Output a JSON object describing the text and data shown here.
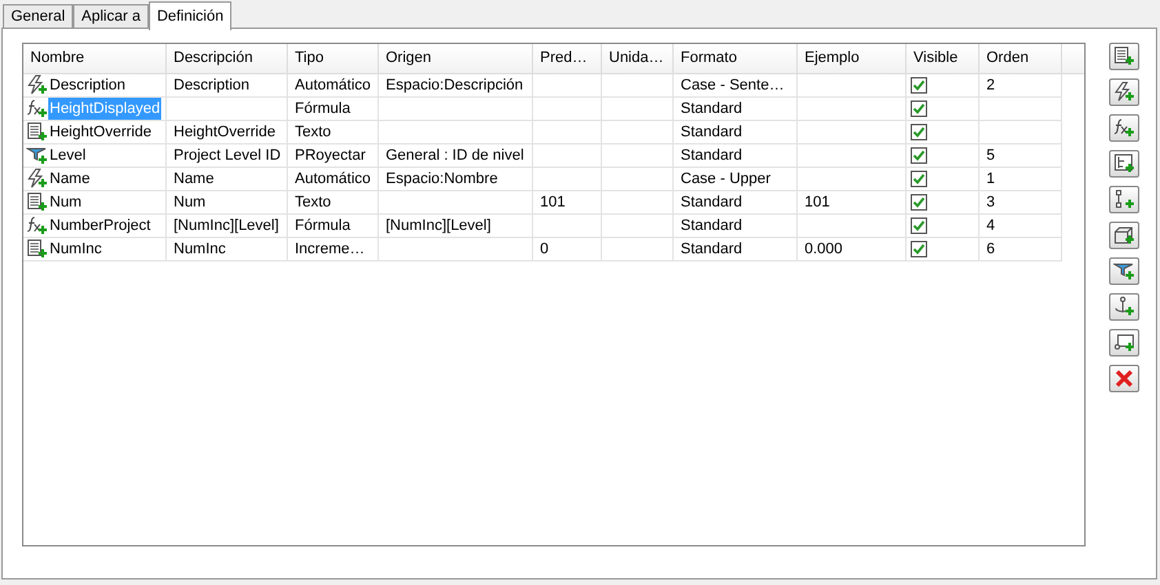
{
  "tabs": [
    {
      "label": "General",
      "selected": false
    },
    {
      "label": "Aplicar a",
      "selected": false
    },
    {
      "label": "Definición",
      "selected": true
    }
  ],
  "table": {
    "columns": [
      "Nombre",
      "Descripción",
      "Tipo",
      "Origen",
      "Pred…",
      "Unida…",
      "Formato",
      "Ejemplo",
      "Visible",
      "Orden"
    ],
    "rows": [
      {
        "kind": "auto",
        "selected": false,
        "name": "Description",
        "description": "Description",
        "tipo": "Automático",
        "origen": "Espacio:Descripción",
        "pred": "",
        "unidad": "",
        "formato": "Case - Sente…",
        "ejemplo": "",
        "visible": true,
        "orden": "2"
      },
      {
        "kind": "formula",
        "selected": true,
        "name": "HeightDisplayed",
        "description": "",
        "tipo": "Fórmula",
        "origen": "",
        "pred": "",
        "unidad": "",
        "formato": "Standard",
        "ejemplo": "",
        "visible": true,
        "orden": ""
      },
      {
        "kind": "text",
        "selected": false,
        "name": "HeightOverride",
        "description": "HeightOverride",
        "tipo": "Texto",
        "origen": "",
        "pred": "",
        "unidad": "",
        "formato": "Standard",
        "ejemplo": "",
        "visible": true,
        "orden": ""
      },
      {
        "kind": "project",
        "selected": false,
        "name": "Level",
        "description": "Project Level ID",
        "tipo": "PRoyectar",
        "origen": "General : ID de nivel",
        "pred": "",
        "unidad": "",
        "formato": "Standard",
        "ejemplo": "",
        "visible": true,
        "orden": "5"
      },
      {
        "kind": "auto",
        "selected": false,
        "name": "Name",
        "description": "Name",
        "tipo": "Automático",
        "origen": "Espacio:Nombre",
        "pred": "",
        "unidad": "",
        "formato": "Case - Upper",
        "ejemplo": "",
        "visible": true,
        "orden": "1"
      },
      {
        "kind": "text",
        "selected": false,
        "name": "Num",
        "description": "Num",
        "tipo": "Texto",
        "origen": "",
        "pred": "101",
        "unidad": "",
        "formato": "Standard",
        "ejemplo": "101",
        "visible": true,
        "orden": "3"
      },
      {
        "kind": "formula",
        "selected": false,
        "name": "NumberProject",
        "description": "[NumInc][Level]",
        "tipo": "Fórmula",
        "origen": "[NumInc][Level]",
        "pred": "",
        "unidad": "",
        "formato": "Standard",
        "ejemplo": "",
        "visible": true,
        "orden": "4"
      },
      {
        "kind": "text",
        "selected": false,
        "name": "NumInc",
        "description": "NumInc",
        "tipo": "Increme…",
        "origen": "",
        "pred": "0",
        "unidad": "",
        "formato": "Standard",
        "ejemplo": "0.000",
        "visible": true,
        "orden": "6"
      }
    ]
  },
  "side_buttons": [
    {
      "kind": "text"
    },
    {
      "kind": "auto"
    },
    {
      "kind": "formula"
    },
    {
      "kind": "classification"
    },
    {
      "kind": "list"
    },
    {
      "kind": "material"
    },
    {
      "kind": "project"
    },
    {
      "kind": "anchor"
    },
    {
      "kind": "graphic"
    },
    {
      "kind": "delete"
    }
  ]
}
